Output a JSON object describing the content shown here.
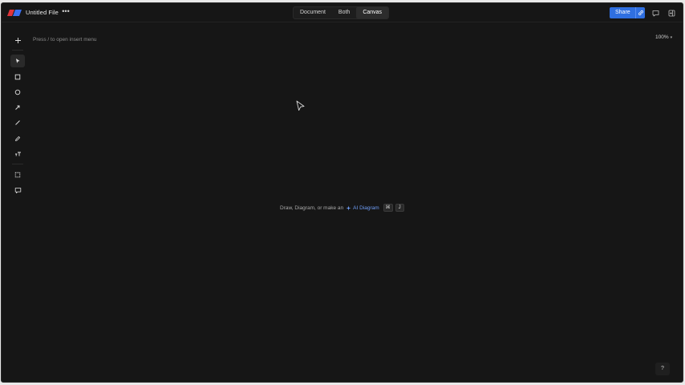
{
  "file": {
    "title": "Untitled File",
    "more_label": "•••"
  },
  "view_switch": {
    "tabs": [
      {
        "label": "Document",
        "active": false
      },
      {
        "label": "Both",
        "active": false
      },
      {
        "label": "Canvas",
        "active": true
      }
    ]
  },
  "share": {
    "label": "Share"
  },
  "canvas": {
    "insert_hint": "Press / to open insert menu",
    "zoom": "100%",
    "center_hint_text": "Draw, Diagram, or make an",
    "ai_link": "AI Diagram",
    "shortcut_keys": [
      "⌘",
      "J"
    ],
    "help_label": "?"
  },
  "toolbar": {
    "tools": [
      {
        "icon": "plus-icon"
      },
      {
        "icon": "select-arrow-icon",
        "selected": true
      },
      {
        "icon": "rectangle-icon"
      },
      {
        "icon": "ellipse-icon"
      },
      {
        "icon": "arrow-icon"
      },
      {
        "icon": "line-icon"
      },
      {
        "icon": "pencil-icon"
      },
      {
        "icon": "text-icon"
      },
      {
        "icon": "frame-icon"
      },
      {
        "icon": "comment-icon"
      }
    ]
  },
  "colors": {
    "background": "#161616",
    "accent": "#2f6fe0",
    "link": "#6f9df6",
    "logo_red": "#e0333a",
    "logo_blue": "#3a6ff0"
  }
}
